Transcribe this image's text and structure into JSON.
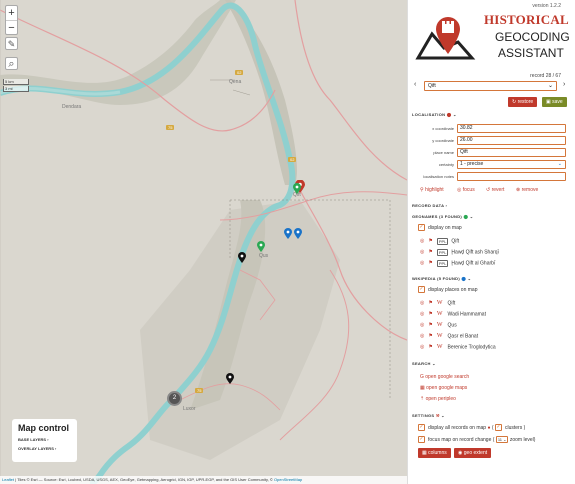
{
  "app": {
    "version": "version 1.2.2",
    "logo_line1": "HISTORICAL",
    "logo_line2": "GEOCODING",
    "logo_line3": "ASSISTANT"
  },
  "record": {
    "counter": "record 28 / 67",
    "selected": "Qift",
    "restore_label": "restore",
    "save_label": "save"
  },
  "localisation": {
    "title": "LOCALISATION",
    "fields": [
      {
        "label": "x coordinate",
        "value": "30.82"
      },
      {
        "label": "y coordinate",
        "value": "26.00"
      },
      {
        "label": "place name",
        "value": "Qift"
      },
      {
        "label": "certainty",
        "value": "1 - precise"
      },
      {
        "label": "localisation notes",
        "value": ""
      }
    ],
    "actions": [
      "highlight",
      "focus",
      "revert",
      "remove"
    ]
  },
  "record_data": {
    "title": "RECORD DATA"
  },
  "geonames": {
    "title": "GEONAMES (3 FOUND)",
    "display_label": "display on map",
    "items": [
      {
        "tag": "PPL",
        "name": "Qift"
      },
      {
        "tag": "PPL",
        "name": "Ḩawḑ Qift ash Sharqī"
      },
      {
        "tag": "PPL",
        "name": "Ḩawḑ Qift al Gharbī"
      }
    ]
  },
  "wikipedia": {
    "title": "WIKIPEDIA (5 FOUND)",
    "display_label": "display places on map",
    "items": [
      {
        "name": "Qift"
      },
      {
        "name": "Wadi Hammamat"
      },
      {
        "name": "Qus"
      },
      {
        "name": "Qasr el Banat"
      },
      {
        "name": "Berenice Troglodytica"
      }
    ]
  },
  "search": {
    "title": "SEARCH",
    "links": [
      "open google search",
      "open google maps",
      "open peripleo"
    ]
  },
  "settings": {
    "title": "SETTINGS",
    "display_all_label": "display all records on map",
    "clusters_label": "clusters )",
    "focus_label": "focus map on record change (",
    "zoom_value": "11",
    "zoom_suffix": "zoom level)",
    "columns_label": "columns",
    "geo_extent_label": "geo extent"
  },
  "map": {
    "zoom_in": "+",
    "zoom_out": "−",
    "edit_icon": "✎",
    "search_icon": "⌕",
    "scale_km": "5 km",
    "scale_mi": "3 mi",
    "labels": {
      "qena": "Qena",
      "qift": "Qift",
      "qus": "Qus",
      "luxor": "Luxor",
      "kharga": "Dendara"
    },
    "roads": [
      "75",
      "02",
      "75",
      "02"
    ],
    "cluster_count": "2",
    "control_title": "Map control",
    "base_layers": "BASE LAYERS",
    "overlay_layers": "OVERLAY LAYERS",
    "attribution_link": "Leaflet",
    "attribution_text": " | Tiles © Esri — Source: Esri, i-cubed, USDA, USGS, AEX, GeoEye, Getmapping, Aerogrid, IGN, IGP, UPR-EGP, and the GIS User Community, © ",
    "attribution_link2": "OpenStreetMap"
  },
  "colors": {
    "accent": "#d4763a",
    "brand_red": "#c0392b",
    "save_green": "#7a8b27",
    "river": "#8fd0cf",
    "pin_blue": "#1a73c8",
    "pin_green": "#2aa853"
  }
}
